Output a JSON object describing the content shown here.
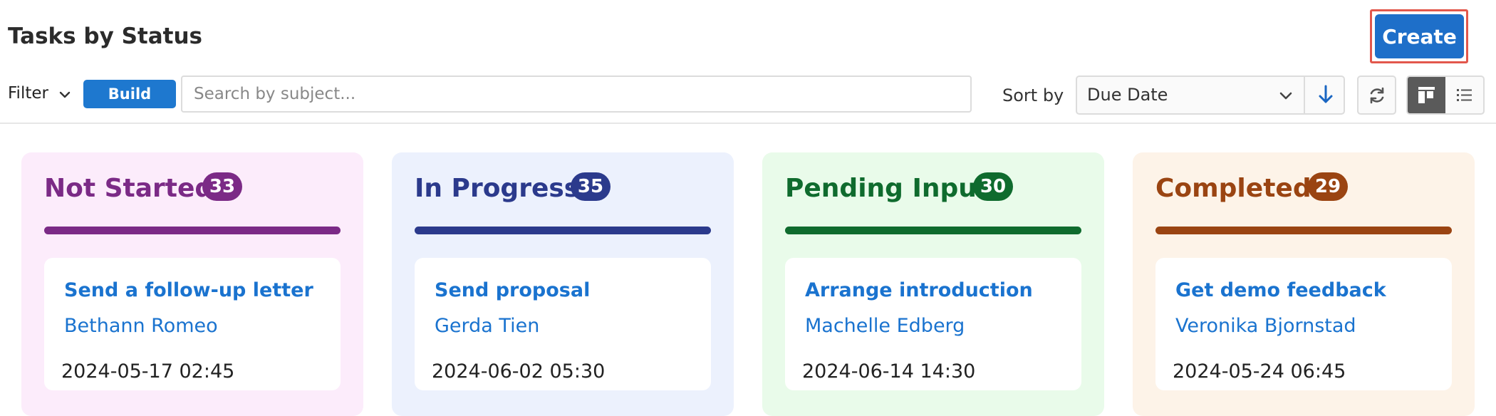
{
  "header": {
    "title": "Tasks by Status",
    "create_label": "Create"
  },
  "toolbar": {
    "filter_label": "Filter",
    "build_filter_label": "Build Filter",
    "search_placeholder": "Search by subject...",
    "sort_by_label": "Sort by",
    "sort_field": "Due Date",
    "sort_direction": "descending",
    "active_view": "board"
  },
  "columns": [
    {
      "title": "Not Started",
      "count": "33",
      "color": "#7b2a86",
      "bg": "#fcecfb",
      "card": {
        "subject": "Send a follow-up letter",
        "contact": "Bethann Romeo",
        "date": "2024-05-17 02:45"
      }
    },
    {
      "title": "In Progress",
      "count": "35",
      "color": "#2b3a8c",
      "bg": "#ecf1fd",
      "card": {
        "subject": "Send proposal",
        "contact": "Gerda Tien",
        "date": "2024-06-02 05:30"
      }
    },
    {
      "title": "Pending Input",
      "count": "30",
      "color": "#0f6b2e",
      "bg": "#e9fbea",
      "card": {
        "subject": "Arrange introduction",
        "contact": "Machelle Edberg",
        "date": "2024-06-14 14:30"
      }
    },
    {
      "title": "Completed",
      "count": "29",
      "color": "#9a4412",
      "bg": "#fdf3e8",
      "card": {
        "subject": "Get demo feedback",
        "contact": "Veronika Bjornstad",
        "date": "2024-05-24 06:45"
      }
    }
  ],
  "colors": {
    "primary": "#1e6fc9",
    "highlight": "#e2574c"
  }
}
